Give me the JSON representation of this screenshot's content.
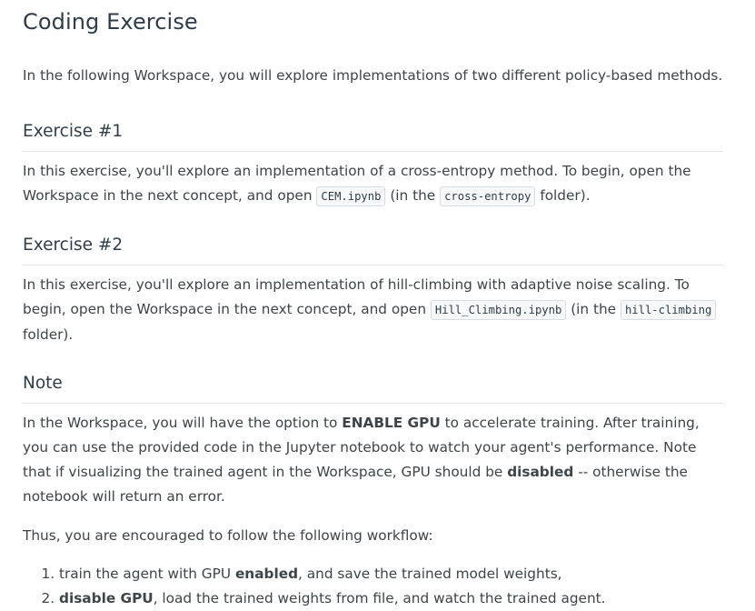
{
  "title": "Coding Exercise",
  "intro": "In the following Workspace, you will explore implementations of two different policy-based methods.",
  "exercise1": {
    "heading": "Exercise #1",
    "text_before": "In this exercise, you'll explore an implementation of a cross-entropy method. To begin, open the Workspace in the next concept, and open ",
    "code1": "CEM.ipynb",
    "text_middle": " (in the ",
    "code2": "cross-entropy",
    "text_after": " folder)."
  },
  "exercise2": {
    "heading": "Exercise #2",
    "text_before": "In this exercise, you'll explore an implementation of hill-climbing with adaptive noise scaling. To begin, open the Workspace in the next concept, and open ",
    "code1": "Hill_Climbing.ipynb",
    "text_middle": " (in the ",
    "code2": "hill-climbing",
    "text_after": " folder)."
  },
  "note": {
    "heading": "Note",
    "p1_a": "In the Workspace, you will have the option to ",
    "p1_bold1": "ENABLE GPU",
    "p1_b": " to accelerate training. After training, you can use the provided code in the Jupyter notebook to watch your agent's performance. Note that if visualizing the trained agent in the Workspace, GPU should be ",
    "p1_bold2": "disabled",
    "p1_c": " -- otherwise the notebook will return an error.",
    "p2": "Thus, you are encouraged to follow the following workflow:",
    "steps": [
      {
        "a": "train the agent with GPU ",
        "bold": "enabled",
        "b": ", and save the trained model weights,"
      },
      {
        "bold": "disable GPU",
        "b": ", load the trained weights from file, and watch the trained agent."
      }
    ]
  }
}
